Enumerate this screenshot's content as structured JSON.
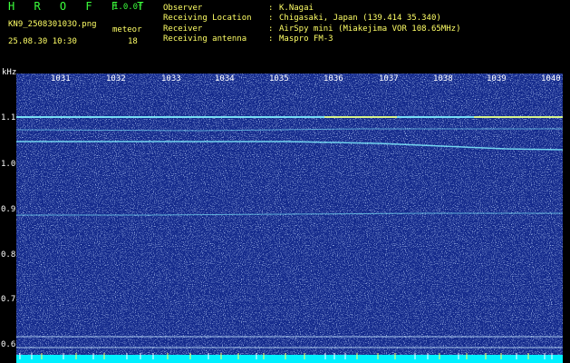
{
  "header": {
    "app_title": "H R O F F T",
    "version": "1.0.0f",
    "filename": "KN9_250830103O.png",
    "meteor_label": "meteor",
    "datetime": "25.08.30 10:30",
    "meteor_count": "18",
    "info": [
      {
        "label": "Observer",
        "value": "K.Nagai"
      },
      {
        "label": "Receiving Location",
        "value": "Chigasaki, Japan (139.414 35.340)"
      },
      {
        "label": "Receiver",
        "value": "AirSpy mini (Miakejima VOR 108.65MHz)"
      },
      {
        "label": "Receiving antenna",
        "value": "Maspro FM-3"
      }
    ]
  },
  "axis": {
    "unit": "kHz",
    "y_ticks": [
      "1.1",
      "1.0",
      "0.9",
      "0.8",
      "0.7",
      "0.6"
    ],
    "x_ticks": [
      "1031",
      "1032",
      "1033",
      "1034",
      "1035",
      "1036",
      "1037",
      "1038",
      "1039",
      "1040"
    ]
  },
  "colors": {
    "background": "#142a8c",
    "trace_cyan": "#80f0ff",
    "trace_yellow": "#ffff60",
    "base_band": "#00f0ff"
  }
}
